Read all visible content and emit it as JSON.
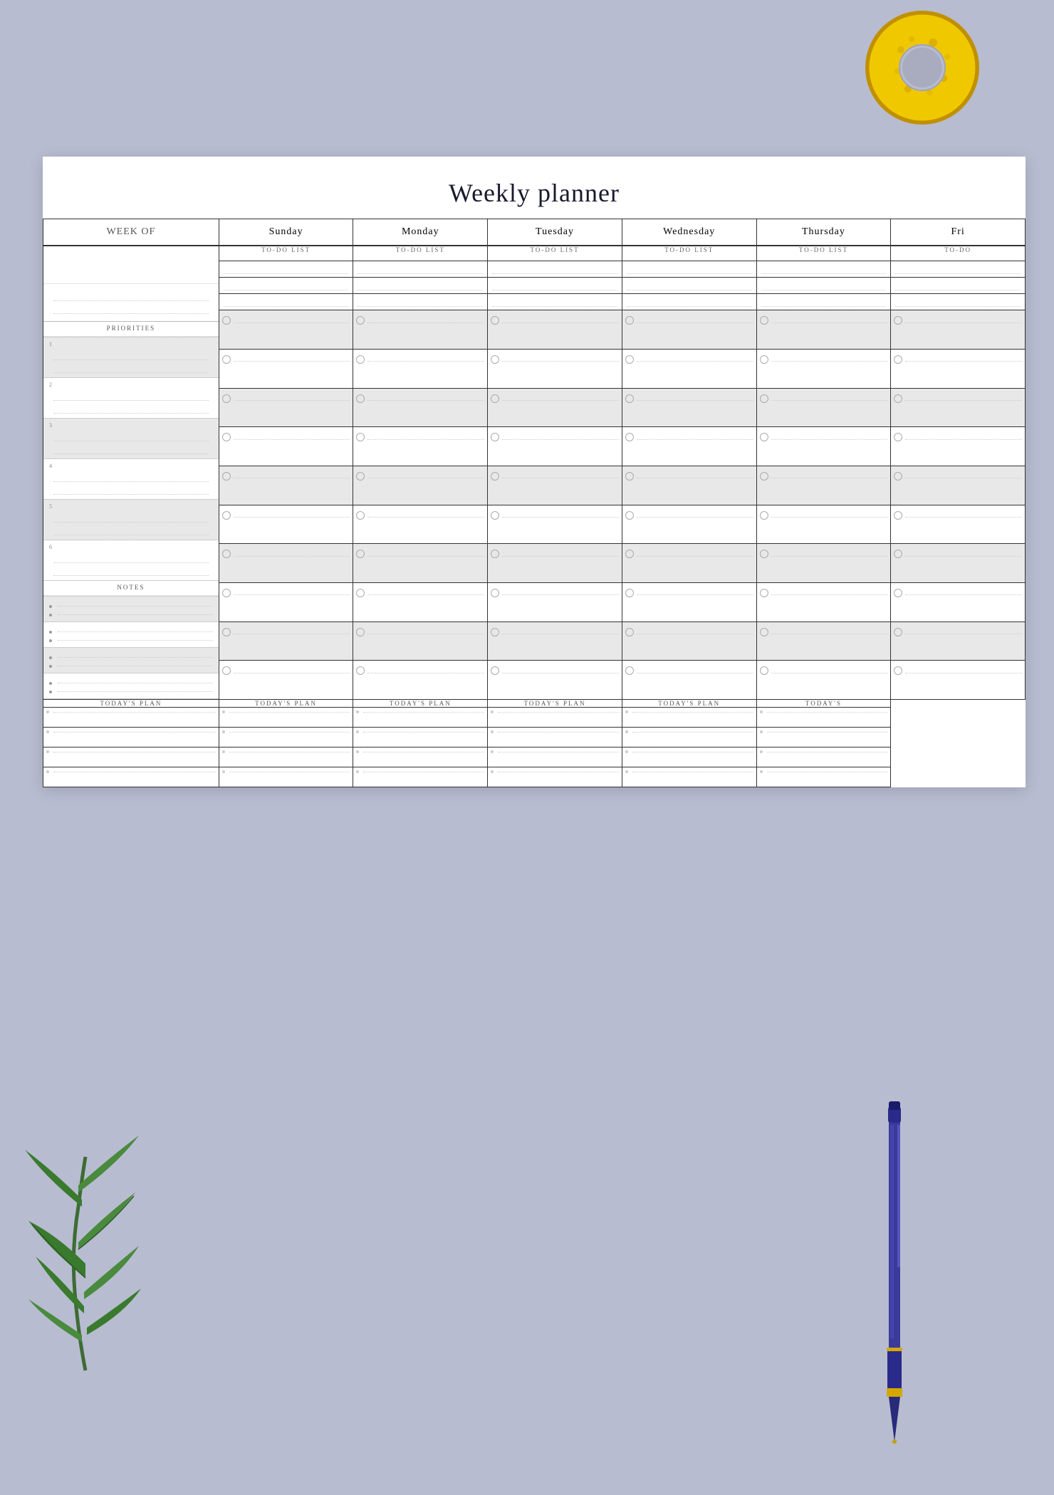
{
  "page": {
    "background_color": "#b8bcd0",
    "title": "Weekly planner"
  },
  "planner": {
    "title": "Weekly planner",
    "week_of_label": "WEEK OF",
    "days": [
      "Sunday",
      "Monday",
      "Tuesday",
      "Wednesday",
      "Thursday",
      "Fri"
    ],
    "todo_label": "TO-DO LIST",
    "priorities_label": "PRIORITIES",
    "notes_label": "NOTES",
    "todays_plan_label": "TODAY'S PLAN",
    "priority_numbers": [
      "1",
      "2",
      "3",
      "4",
      "5",
      "6"
    ]
  }
}
